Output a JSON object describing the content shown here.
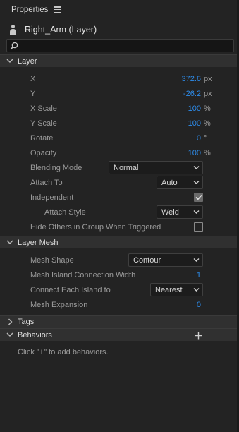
{
  "panel": {
    "title": "Properties"
  },
  "layer": {
    "name": "Right_Arm (Layer)"
  },
  "search": {
    "placeholder": ""
  },
  "sections": {
    "layer": {
      "label": "Layer"
    },
    "layer_mesh": {
      "label": "Layer Mesh"
    },
    "tags": {
      "label": "Tags"
    },
    "behaviors": {
      "label": "Behaviors"
    }
  },
  "layer_props": {
    "x": {
      "label": "X",
      "value": "372.6",
      "unit": "px"
    },
    "y": {
      "label": "Y",
      "value": "-26.2",
      "unit": "px"
    },
    "x_scale": {
      "label": "X Scale",
      "value": "100",
      "unit": "%"
    },
    "y_scale": {
      "label": "Y Scale",
      "value": "100",
      "unit": "%"
    },
    "rotate": {
      "label": "Rotate",
      "value": "0",
      "unit": "°"
    },
    "opacity": {
      "label": "Opacity",
      "value": "100",
      "unit": "%"
    },
    "blending_mode": {
      "label": "Blending Mode",
      "value": "Normal"
    },
    "attach_to": {
      "label": "Attach To",
      "value": "Auto"
    },
    "independent": {
      "label": "Independent",
      "checked": true
    },
    "attach_style": {
      "label": "Attach Style",
      "value": "Weld"
    },
    "hide_others": {
      "label": "Hide Others in Group When Triggered",
      "checked": false
    }
  },
  "mesh_props": {
    "mesh_shape": {
      "label": "Mesh Shape",
      "value": "Contour"
    },
    "island_width": {
      "label": "Mesh Island Connection Width",
      "value": "1"
    },
    "connect_island": {
      "label": "Connect Each Island to",
      "value": "Nearest"
    },
    "expansion": {
      "label": "Mesh Expansion",
      "value": "0"
    }
  },
  "behaviors": {
    "hint": "Click \"+\" to add behaviors."
  },
  "colors": {
    "accent": "#2d8ceb",
    "background": "#232323",
    "section": "#303030"
  },
  "icons": {
    "menu": "hamburger-menu-icon",
    "layer": "puppet-person-icon",
    "search": "magnifier-icon",
    "expand": "chevron-down-icon",
    "collapse": "chevron-right-icon",
    "add": "plus-icon",
    "dropdown": "caret-down-icon",
    "check": "checkmark-icon"
  }
}
